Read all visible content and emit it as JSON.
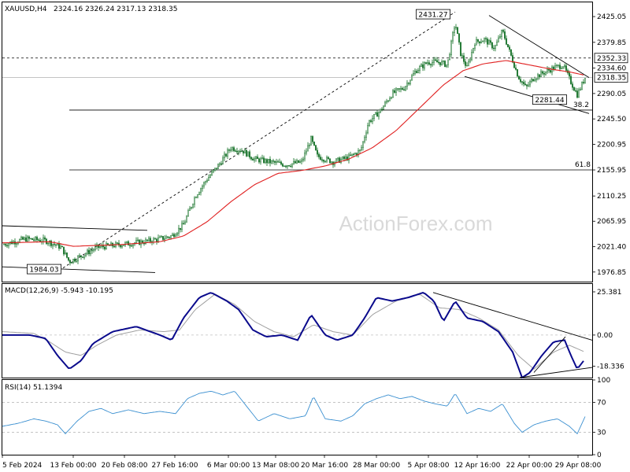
{
  "header": {
    "symbol": "XAUUSD,H4",
    "ohlc": "2324.16 2326.24 2317.13 2318.35"
  },
  "watermark": "ActionForex.com",
  "colors": {
    "candles": "#0b6b1e",
    "ema": "#e02020",
    "macd_line": "#0a0a8c",
    "signal_line": "#a0a0a0",
    "rsi_line": "#3a8fd0",
    "trend_lines": "#000000",
    "fib_lines": "#000000",
    "dotted_level": "#000000",
    "label_box_bg": "#ffffff"
  },
  "chart_data": [
    {
      "type": "candlestick",
      "panel": "price",
      "title": "XAUUSD,H4",
      "ylim": [
        1960,
        2450
      ],
      "x_ticks": [
        "5 Feb 2024",
        "13 Feb 00:00",
        "20 Feb 08:00",
        "27 Feb 16:00",
        "6 Mar 00:00",
        "13 Mar 08:00",
        "20 Mar 16:00",
        "28 Mar 00:00",
        "5 Apr 08:00",
        "12 Apr 16:00",
        "22 Apr 00:00",
        "29 Apr 08:00"
      ],
      "y_ticks": [
        "2425.05",
        "2379.85",
        "2334.60",
        "2290.05",
        "2245.50",
        "2200.95",
        "2155.95",
        "2110.25",
        "2065.95",
        "2021.40",
        "1976.85"
      ],
      "current_price_label": "2318.35",
      "level_label": "2352.33",
      "close_anchors": [
        [
          0,
          2025
        ],
        [
          30,
          2035
        ],
        [
          55,
          2032
        ],
        [
          75,
          2020
        ],
        [
          85,
          1995
        ],
        [
          100,
          2005
        ],
        [
          120,
          2020
        ],
        [
          150,
          2025
        ],
        [
          180,
          2030
        ],
        [
          200,
          2035
        ],
        [
          215,
          2040
        ],
        [
          230,
          2060
        ],
        [
          245,
          2110
        ],
        [
          260,
          2140
        ],
        [
          275,
          2165
        ],
        [
          290,
          2195
        ],
        [
          305,
          2190
        ],
        [
          320,
          2175
        ],
        [
          340,
          2170
        ],
        [
          360,
          2165
        ],
        [
          380,
          2170
        ],
        [
          392,
          2210
        ],
        [
          400,
          2180
        ],
        [
          420,
          2170
        ],
        [
          440,
          2178
        ],
        [
          455,
          2190
        ],
        [
          465,
          2240
        ],
        [
          480,
          2260
        ],
        [
          495,
          2290
        ],
        [
          510,
          2300
        ],
        [
          525,
          2330
        ],
        [
          540,
          2345
        ],
        [
          555,
          2345
        ],
        [
          565,
          2340
        ],
        [
          575,
          2415
        ],
        [
          582,
          2360
        ],
        [
          590,
          2335
        ],
        [
          600,
          2380
        ],
        [
          612,
          2385
        ],
        [
          625,
          2370
        ],
        [
          635,
          2400
        ],
        [
          645,
          2360
        ],
        [
          655,
          2320
        ],
        [
          665,
          2300
        ],
        [
          675,
          2318
        ],
        [
          685,
          2325
        ],
        [
          700,
          2335
        ],
        [
          712,
          2340
        ],
        [
          722,
          2310
        ],
        [
          730,
          2288
        ],
        [
          740,
          2318
        ]
      ],
      "ema_anchors": [
        [
          0,
          2028
        ],
        [
          60,
          2030
        ],
        [
          90,
          2022
        ],
        [
          150,
          2025
        ],
        [
          200,
          2030
        ],
        [
          230,
          2040
        ],
        [
          260,
          2065
        ],
        [
          290,
          2100
        ],
        [
          320,
          2130
        ],
        [
          350,
          2150
        ],
        [
          380,
          2155
        ],
        [
          410,
          2163
        ],
        [
          440,
          2175
        ],
        [
          470,
          2195
        ],
        [
          500,
          2225
        ],
        [
          530,
          2265
        ],
        [
          560,
          2305
        ],
        [
          585,
          2330
        ],
        [
          610,
          2342
        ],
        [
          640,
          2348
        ],
        [
          670,
          2340
        ],
        [
          700,
          2332
        ],
        [
          720,
          2328
        ],
        [
          740,
          2322
        ]
      ],
      "annotations": {
        "high": {
          "text": "2431.27",
          "x": 575,
          "y": 2431.27
        },
        "low_april": {
          "text": "2281.44",
          "x": 700,
          "y": 2281.44
        },
        "low_feb": {
          "text": "1984.03",
          "x": 80,
          "y": 1984.03
        },
        "fib_38": {
          "text": "38.2",
          "y": 2261
        },
        "fib_61": {
          "text": "61.8",
          "y": 2156
        },
        "dotted_level": 2352.33,
        "current": 2318.35
      }
    },
    {
      "type": "line",
      "panel": "macd",
      "title": "MACD(12,26,9) -5.943 -10.195",
      "ylim": [
        -25,
        30
      ],
      "y_ticks": [
        "25.381",
        "0.00",
        "-18.336"
      ],
      "macd_anchors": [
        [
          0,
          0
        ],
        [
          35,
          0
        ],
        [
          55,
          -2
        ],
        [
          70,
          -12
        ],
        [
          85,
          -20
        ],
        [
          100,
          -15
        ],
        [
          115,
          -5
        ],
        [
          140,
          2
        ],
        [
          170,
          5
        ],
        [
          200,
          0
        ],
        [
          215,
          -3
        ],
        [
          230,
          10
        ],
        [
          250,
          22
        ],
        [
          265,
          25
        ],
        [
          285,
          20
        ],
        [
          300,
          15
        ],
        [
          318,
          3
        ],
        [
          335,
          -1
        ],
        [
          355,
          0
        ],
        [
          375,
          -3
        ],
        [
          392,
          12
        ],
        [
          410,
          0
        ],
        [
          425,
          -3
        ],
        [
          445,
          0
        ],
        [
          460,
          10
        ],
        [
          475,
          22
        ],
        [
          495,
          20
        ],
        [
          515,
          22
        ],
        [
          535,
          25
        ],
        [
          548,
          20
        ],
        [
          560,
          8
        ],
        [
          575,
          20
        ],
        [
          590,
          10
        ],
        [
          610,
          8
        ],
        [
          630,
          2
        ],
        [
          648,
          -10
        ],
        [
          660,
          -25
        ],
        [
          670,
          -22
        ],
        [
          685,
          -12
        ],
        [
          700,
          -4
        ],
        [
          714,
          -3
        ],
        [
          722,
          -12
        ],
        [
          730,
          -20
        ],
        [
          740,
          -14
        ]
      ],
      "signal_anchors": [
        [
          0,
          2
        ],
        [
          40,
          1
        ],
        [
          60,
          -4
        ],
        [
          80,
          -10
        ],
        [
          100,
          -12
        ],
        [
          120,
          -6
        ],
        [
          145,
          0
        ],
        [
          175,
          3
        ],
        [
          205,
          2
        ],
        [
          225,
          3
        ],
        [
          245,
          15
        ],
        [
          270,
          24
        ],
        [
          295,
          18
        ],
        [
          320,
          8
        ],
        [
          345,
          2
        ],
        [
          370,
          -1
        ],
        [
          395,
          6
        ],
        [
          420,
          2
        ],
        [
          445,
          0
        ],
        [
          470,
          12
        ],
        [
          500,
          20
        ],
        [
          530,
          24
        ],
        [
          555,
          16
        ],
        [
          580,
          15
        ],
        [
          605,
          10
        ],
        [
          630,
          3
        ],
        [
          655,
          -12
        ],
        [
          675,
          -20
        ],
        [
          700,
          -10
        ],
        [
          720,
          -6
        ],
        [
          740,
          -10
        ]
      ]
    },
    {
      "type": "line",
      "panel": "rsi",
      "title": "RSI(14) 51.1394",
      "ylim": [
        0,
        100
      ],
      "y_ticks": [
        "100",
        "70",
        "30",
        "0"
      ],
      "rsi_anchors": [
        [
          0,
          38
        ],
        [
          20,
          42
        ],
        [
          40,
          48
        ],
        [
          55,
          45
        ],
        [
          70,
          40
        ],
        [
          80,
          28
        ],
        [
          95,
          45
        ],
        [
          110,
          58
        ],
        [
          125,
          62
        ],
        [
          140,
          55
        ],
        [
          160,
          60
        ],
        [
          180,
          55
        ],
        [
          200,
          58
        ],
        [
          220,
          55
        ],
        [
          235,
          75
        ],
        [
          250,
          82
        ],
        [
          265,
          85
        ],
        [
          280,
          80
        ],
        [
          295,
          85
        ],
        [
          310,
          65
        ],
        [
          325,
          45
        ],
        [
          345,
          55
        ],
        [
          365,
          48
        ],
        [
          385,
          52
        ],
        [
          395,
          78
        ],
        [
          410,
          48
        ],
        [
          430,
          45
        ],
        [
          445,
          52
        ],
        [
          460,
          68
        ],
        [
          475,
          75
        ],
        [
          490,
          80
        ],
        [
          505,
          75
        ],
        [
          520,
          78
        ],
        [
          535,
          72
        ],
        [
          550,
          68
        ],
        [
          565,
          65
        ],
        [
          575,
          82
        ],
        [
          590,
          55
        ],
        [
          605,
          62
        ],
        [
          620,
          58
        ],
        [
          635,
          68
        ],
        [
          650,
          42
        ],
        [
          660,
          30
        ],
        [
          675,
          40
        ],
        [
          690,
          45
        ],
        [
          705,
          48
        ],
        [
          720,
          38
        ],
        [
          730,
          28
        ],
        [
          740,
          51
        ]
      ]
    }
  ]
}
